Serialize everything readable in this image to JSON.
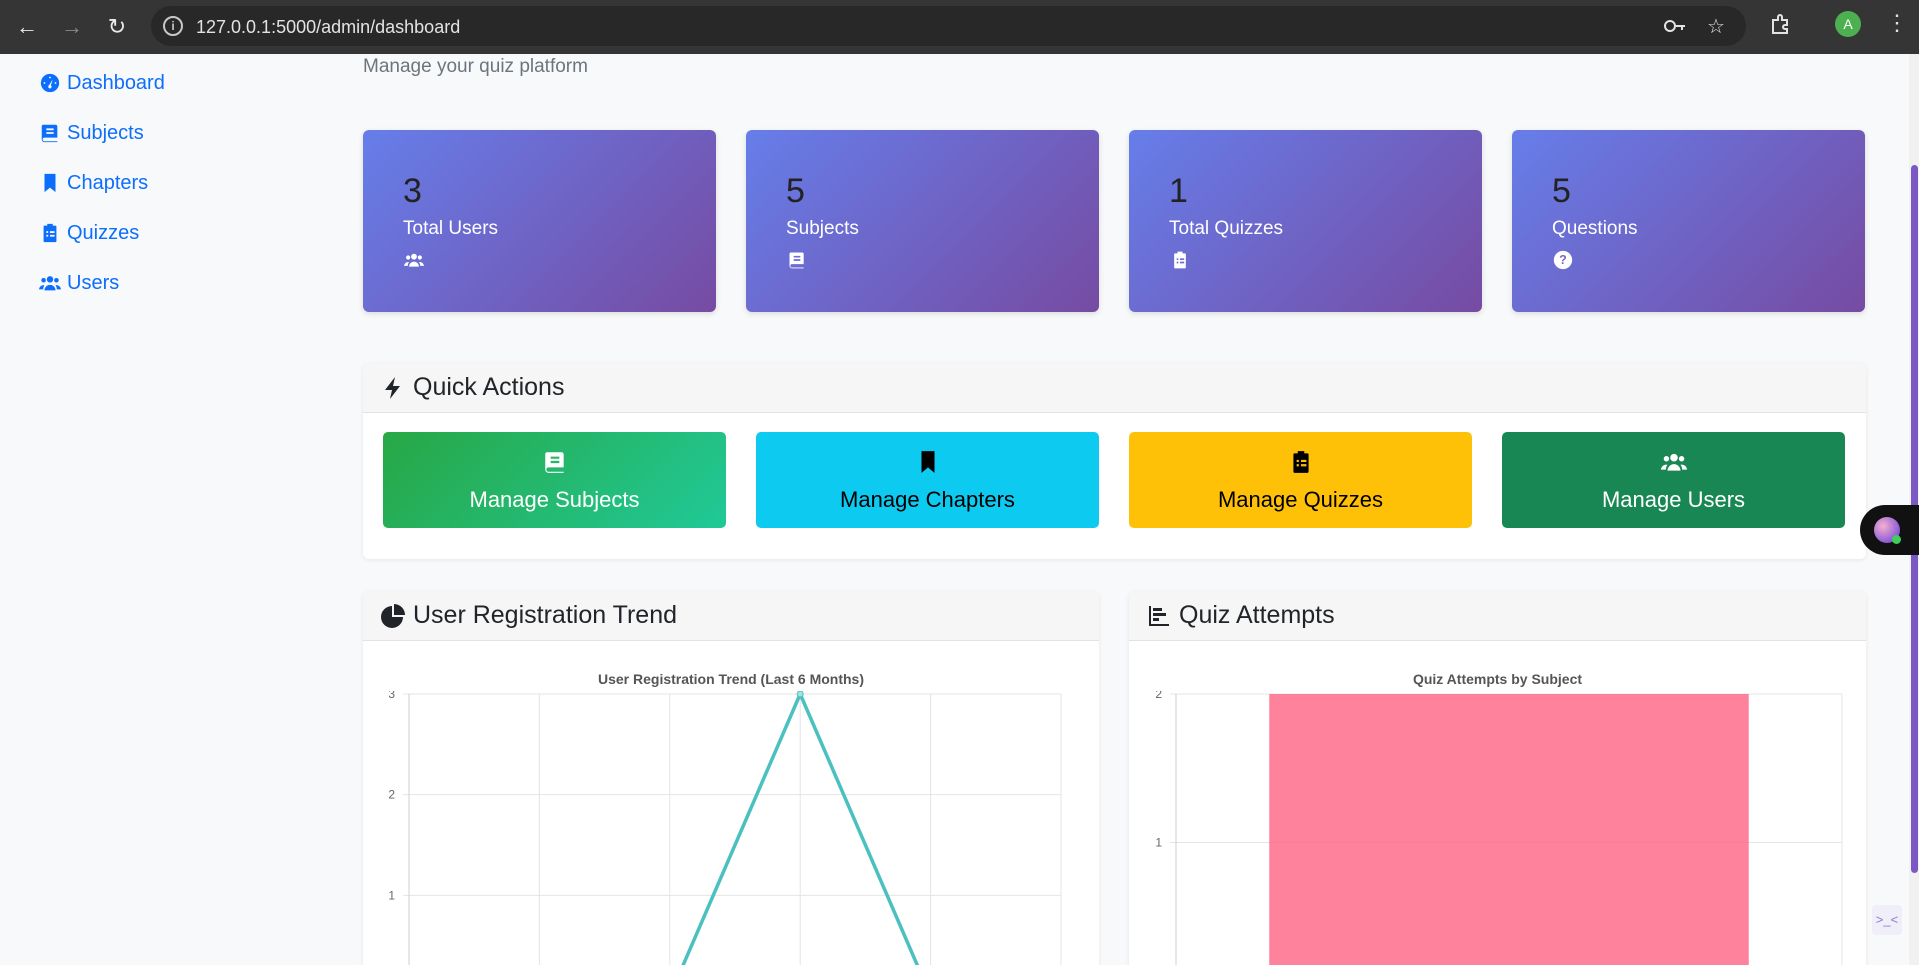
{
  "browser": {
    "url": "127.0.0.1:5000/admin/dashboard",
    "avatar_letter": "A"
  },
  "sidebar": {
    "items": [
      {
        "label": "Dashboard",
        "icon": "tachometer-icon"
      },
      {
        "label": "Subjects",
        "icon": "book-icon"
      },
      {
        "label": "Chapters",
        "icon": "bookmark-icon"
      },
      {
        "label": "Quizzes",
        "icon": "clipboard-list-icon"
      },
      {
        "label": "Users",
        "icon": "users-icon"
      }
    ]
  },
  "header": {
    "subtitle": "Manage your quiz platform"
  },
  "stats": [
    {
      "value": "3",
      "label": "Total Users",
      "icon": "users-icon"
    },
    {
      "value": "5",
      "label": "Subjects",
      "icon": "book-icon"
    },
    {
      "value": "1",
      "label": "Total Quizzes",
      "icon": "clipboard-list-icon"
    },
    {
      "value": "5",
      "label": "Questions",
      "icon": "question-circle-icon"
    }
  ],
  "quick_actions": {
    "title": "Quick Actions",
    "buttons": [
      {
        "label": "Manage Subjects",
        "icon": "book-icon",
        "color": "#28a745"
      },
      {
        "label": "Manage Chapters",
        "icon": "bookmark-icon",
        "color": "#0dcaf0"
      },
      {
        "label": "Manage Quizzes",
        "icon": "clipboard-list-icon",
        "color": "#ffc107"
      },
      {
        "label": "Manage Users",
        "icon": "users-icon",
        "color": "#198754"
      }
    ]
  },
  "registration_panel": {
    "title": "User Registration Trend"
  },
  "attempts_panel": {
    "title": "Quiz Attempts"
  },
  "chart_data": [
    {
      "type": "line",
      "title": "User Registration Trend (Last 6 Months)",
      "x": [
        "",
        "",
        "",
        "",
        "",
        ""
      ],
      "series": [
        {
          "values": [
            0,
            0,
            0,
            3,
            0,
            0
          ],
          "color": "#4bc0c0"
        }
      ],
      "yticks": [
        "3",
        "2",
        "1"
      ],
      "ylim": [
        0,
        3
      ],
      "grid": true
    },
    {
      "type": "bar",
      "title": "Quiz Attempts by Subject",
      "categories": [
        ""
      ],
      "series": [
        {
          "values": [
            2
          ],
          "color": "#ff6384"
        }
      ],
      "yticks": [
        "2",
        "1"
      ],
      "ylim": [
        0,
        2
      ],
      "grid": true
    }
  ]
}
